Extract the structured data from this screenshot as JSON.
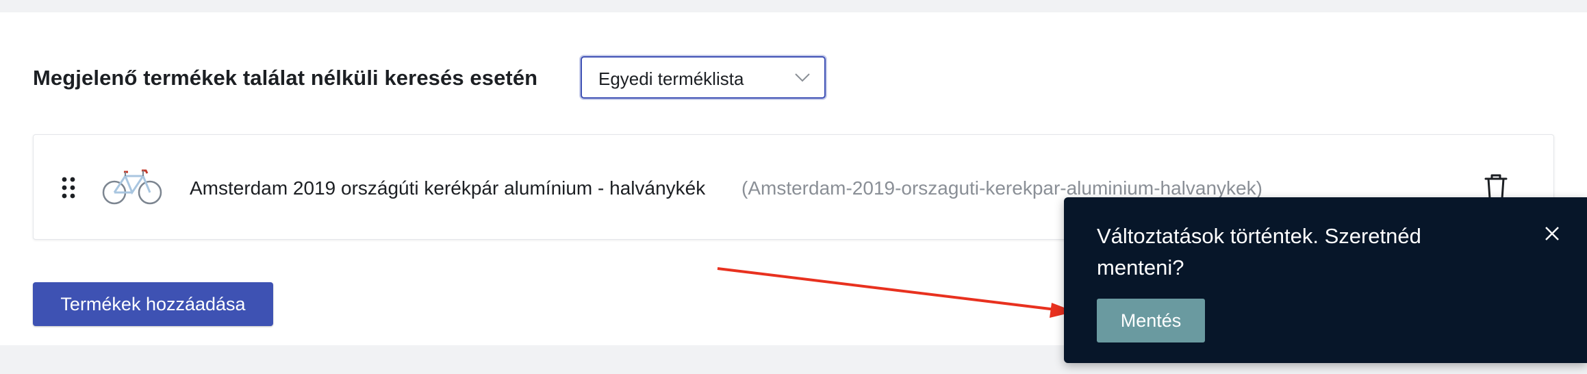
{
  "settings": {
    "section_title": "Megjelenő termékek találat nélküli keresés esetén",
    "select": {
      "value": "Egyedi terméklista"
    }
  },
  "products": [
    {
      "name": "Amsterdam 2019 országúti kerékpár alumínium - halványkék",
      "slug": "(Amsterdam-2019-orszaguti-kerekpar-aluminium-halvanykek)",
      "image_icon": "bicycle"
    }
  ],
  "actions": {
    "add_products_label": "Termékek hozzáadása"
  },
  "toast": {
    "message": "Változtatások történtek. Szeretnéd menteni?",
    "save_label": "Mentés",
    "close_icon": "close-icon"
  },
  "colors": {
    "primary": "#3e52b3",
    "toast_bg": "#071629",
    "save_button": "#6a9aa0",
    "annotation_arrow": "#e8311f"
  }
}
